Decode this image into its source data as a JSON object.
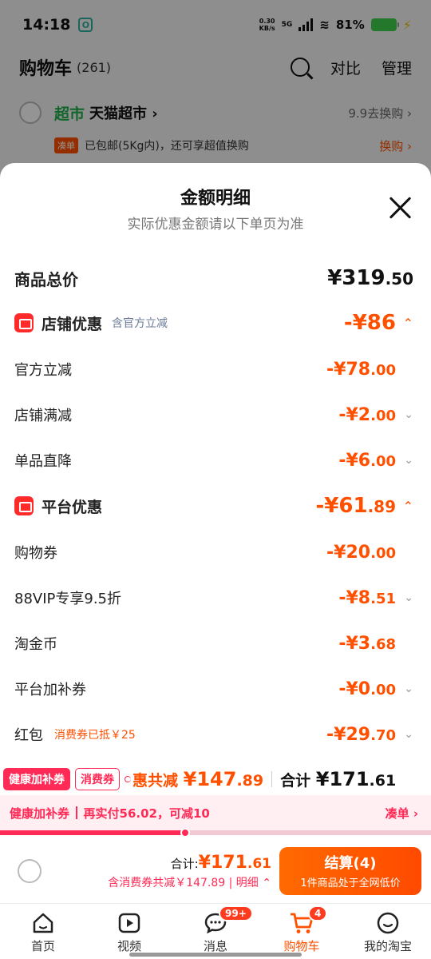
{
  "status": {
    "time": "14:18",
    "app_icon": "O",
    "net_speed": "0.30",
    "net_unit": "KB/s",
    "network": "5G",
    "battery": "81%"
  },
  "cart": {
    "title": "购物车",
    "count": "(261)",
    "compare": "对比",
    "manage": "管理",
    "store_tag": "超市",
    "store_name": "天猫超市 ›",
    "store_link": "9.9去换购 ›",
    "ship_badge": "凑单",
    "ship_text": "已包邮(5Kg内)，还可享超值换购",
    "ship_link": "换购 ›"
  },
  "sheet": {
    "title": "金额明细",
    "subtitle": "实际优惠金额请以下单页为准",
    "total": {
      "label": "商品总价",
      "int": "¥319",
      "dec": ".50"
    },
    "store_discount": {
      "label": "店铺优惠",
      "note": "含官方立减",
      "int": "-¥86",
      "dec": ""
    },
    "store_items": [
      {
        "label": "官方立减",
        "int": "-¥78",
        "dec": ".00",
        "chev": ""
      },
      {
        "label": "店铺满减",
        "int": "-¥2",
        "dec": ".00",
        "chev": "⌄"
      },
      {
        "label": "单品直降",
        "int": "-¥6",
        "dec": ".00",
        "chev": "⌄"
      }
    ],
    "platform_discount": {
      "label": "平台优惠",
      "int": "-¥61",
      "dec": ".89"
    },
    "platform_items": [
      {
        "label": "购物券",
        "int": "-¥20",
        "dec": ".00",
        "chev": ""
      },
      {
        "label": "88VIP专享9.5折",
        "int": "-¥8",
        "dec": ".51",
        "chev": "⌄"
      },
      {
        "label": "淘金币",
        "int": "-¥3",
        "dec": ".68",
        "chev": ""
      },
      {
        "label": "平台加补券",
        "int": "-¥0",
        "dec": ".00",
        "chev": "⌄"
      },
      {
        "label": "红包",
        "note": "消费券已抵￥25",
        "int": "-¥29",
        "dec": ".70",
        "chev": "⌄"
      }
    ]
  },
  "strip": {
    "chip1": "健康加补券",
    "chip2": "消费券",
    "saved_prefix": "惠共减",
    "saved_int": "¥147",
    "saved_dec": ".89",
    "sum_label": "合计",
    "sum_int": "¥171",
    "sum_dec": ".61"
  },
  "health": {
    "name": "健康加补券",
    "text": "再实付56.02，可减10",
    "link": "凑单 ›",
    "progress": 0.43
  },
  "checkout": {
    "total_label": "合计:",
    "total_int": "¥171",
    "total_dec": ".61",
    "saved_text": "含消费券共减￥147.89 | 明细 ⌃",
    "pay_label": "结算(4)",
    "pay_sub": "1件商品处于全网低价"
  },
  "tabs": [
    {
      "label": "首页",
      "icon": "home-icon"
    },
    {
      "label": "视频",
      "icon": "video-icon"
    },
    {
      "label": "消息",
      "icon": "message-icon",
      "badge": "99+"
    },
    {
      "label": "购物车",
      "icon": "cart-icon",
      "badge": "4",
      "active": true
    },
    {
      "label": "我的淘宝",
      "icon": "profile-icon"
    }
  ],
  "colors": {
    "accent": "#ff5000",
    "coupon": "#ff2a55",
    "supermarket": "#1fae4a"
  }
}
